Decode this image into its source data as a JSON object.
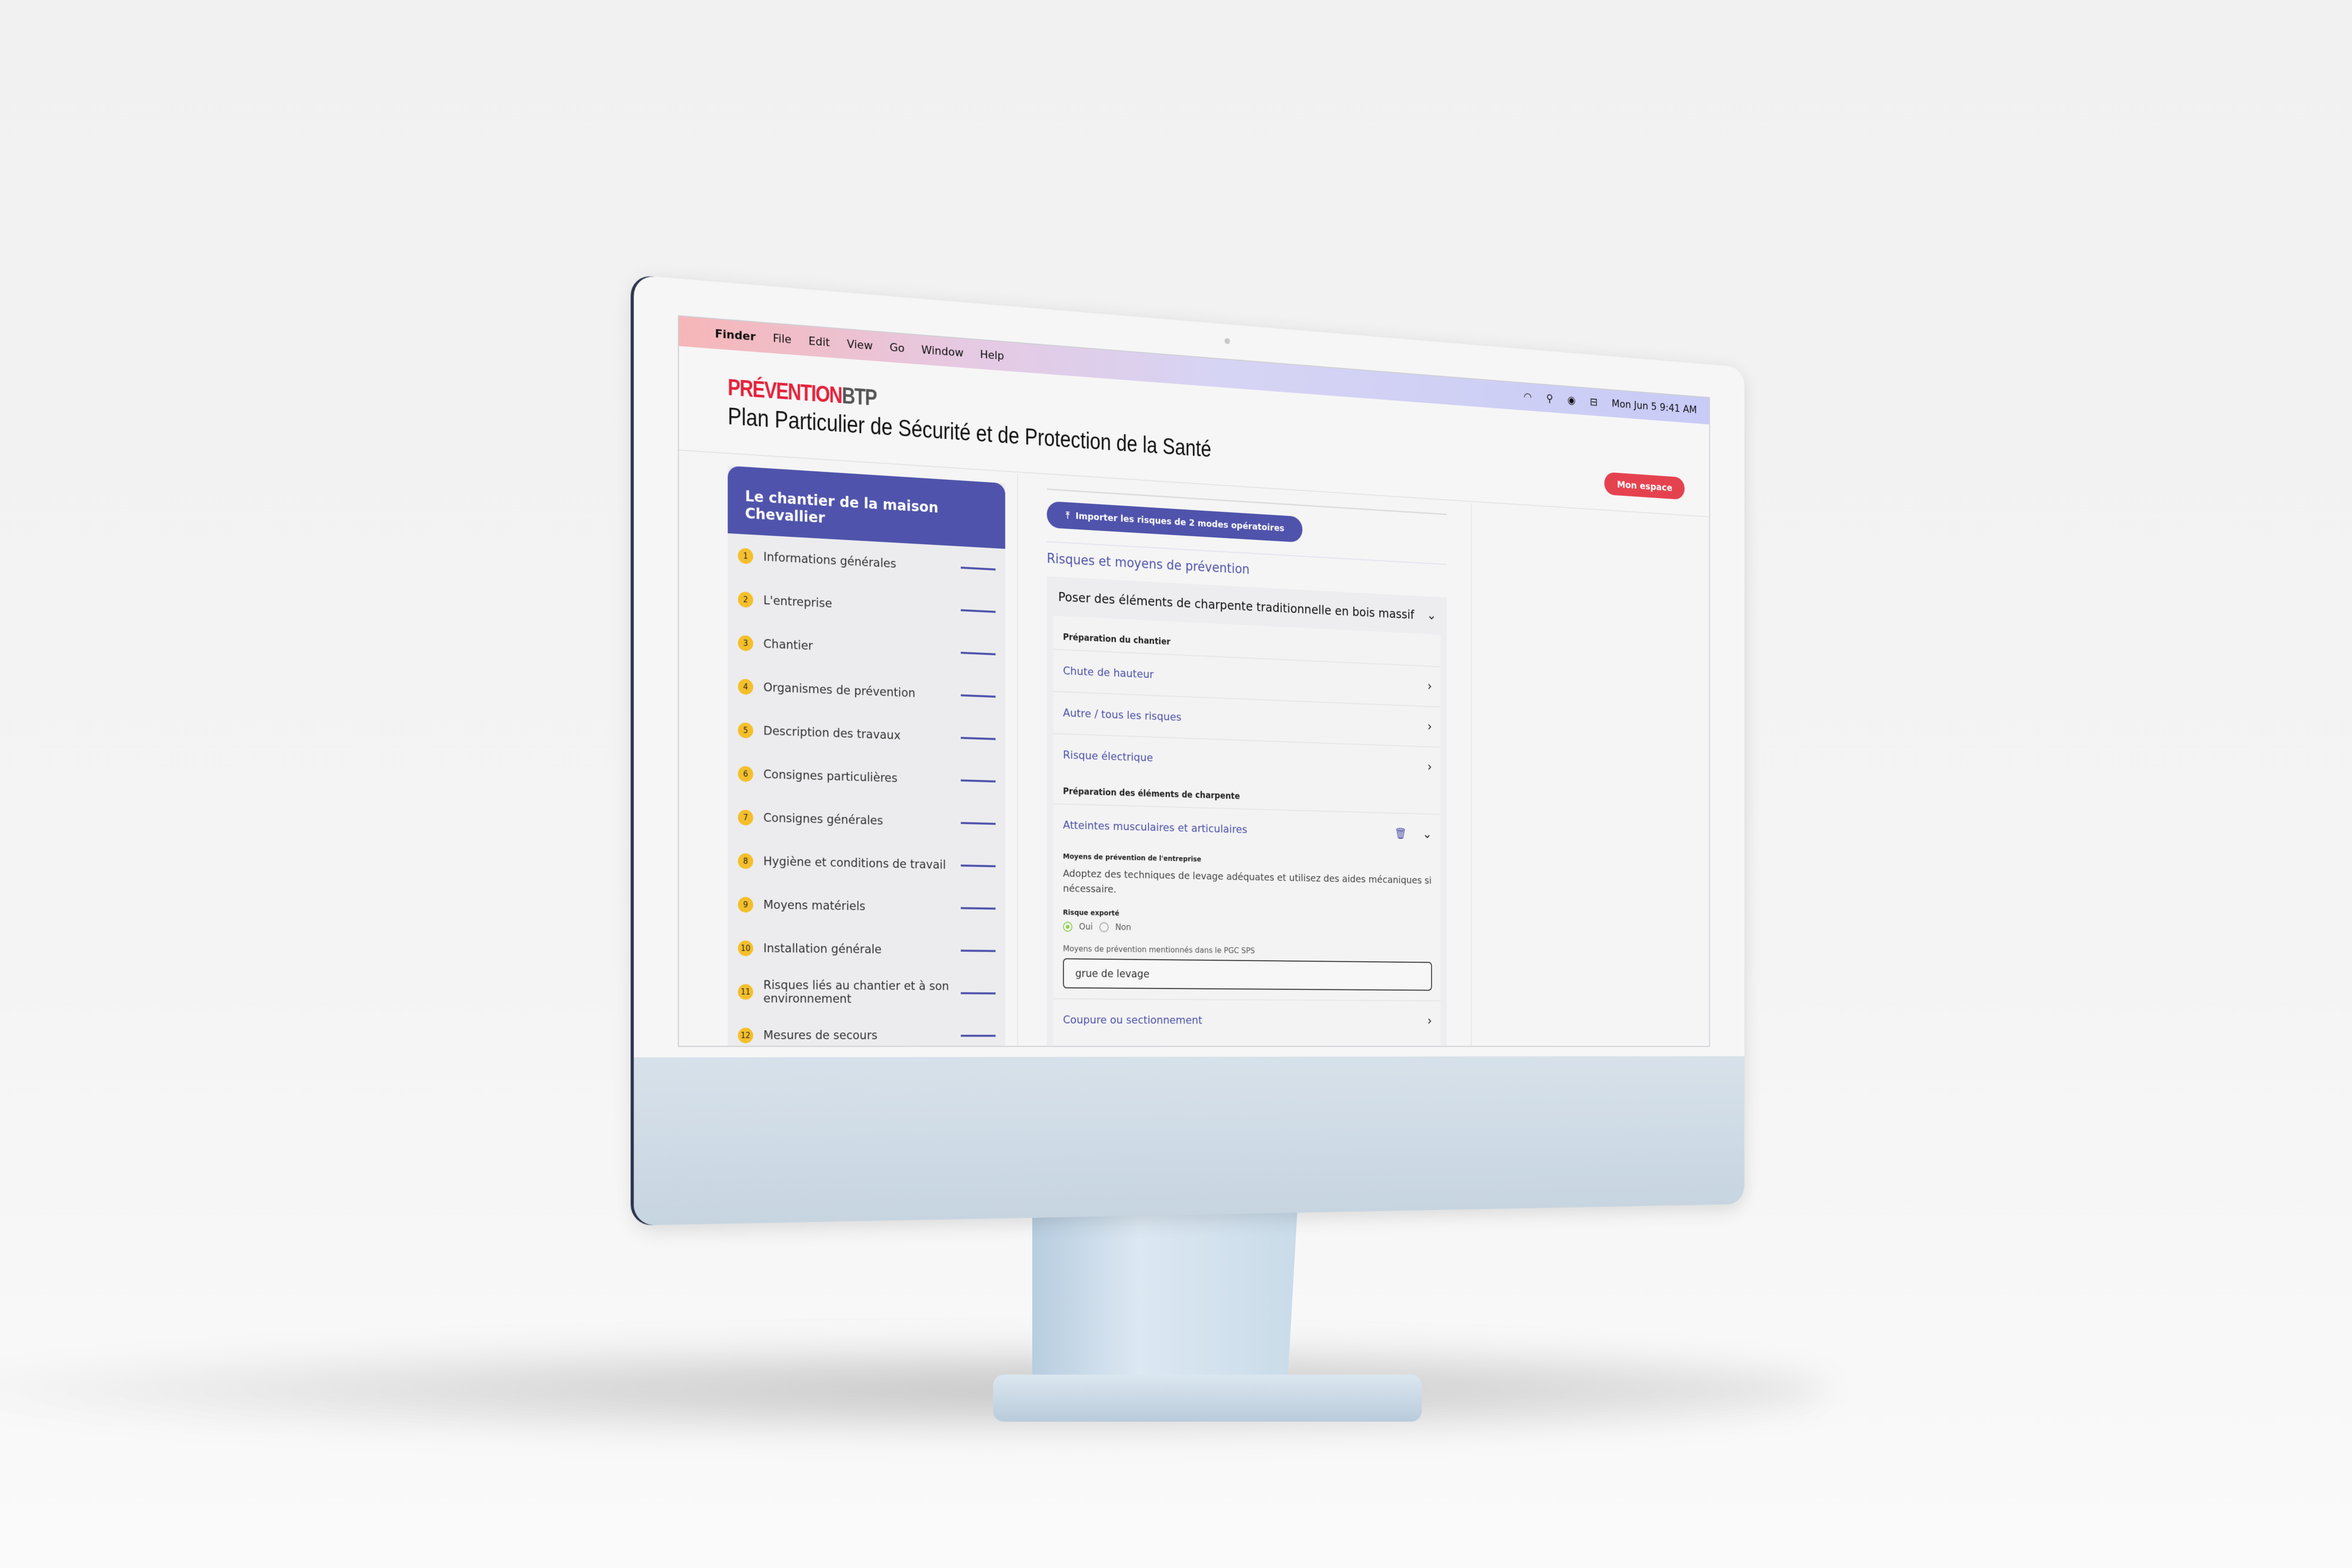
{
  "menubar": {
    "items": [
      "Finder",
      "File",
      "Edit",
      "View",
      "Go",
      "Window",
      "Help"
    ],
    "datetime": "Mon Jun 5  9:41 AM",
    "status_icons": [
      "wifi-icon",
      "search-icon",
      "user-icon",
      "control-center-icon"
    ]
  },
  "header": {
    "logo_a": "PRÉVENTION",
    "logo_b": "BTP",
    "title": "Plan Particulier de Sécurité et de Protection de la Santé",
    "account_button": "Mon espace"
  },
  "sidebar": {
    "title": "Le chantier de la maison Chevallier",
    "items": [
      {
        "n": "1",
        "label": "Informations générales"
      },
      {
        "n": "2",
        "label": "L'entreprise"
      },
      {
        "n": "3",
        "label": "Chantier"
      },
      {
        "n": "4",
        "label": "Organismes de prévention"
      },
      {
        "n": "5",
        "label": "Description des travaux"
      },
      {
        "n": "6",
        "label": "Consignes particulières"
      },
      {
        "n": "7",
        "label": "Consignes générales"
      },
      {
        "n": "8",
        "label": "Hygiène et conditions de travail"
      },
      {
        "n": "9",
        "label": "Moyens matériels"
      },
      {
        "n": "10",
        "label": "Installation générale"
      },
      {
        "n": "11",
        "label": "Risques liés au chantier et à son environnement"
      },
      {
        "n": "12",
        "label": "Mesures de secours"
      }
    ]
  },
  "main": {
    "import_button": "Importer les risques de 2 modes opératoires",
    "section_title": "Risques et moyens de prévention",
    "accordion": {
      "title": "Poser des éléments de charpente traditionnelle en bois massif",
      "group1": "Préparation du chantier",
      "group1_risks": [
        "Chute de hauteur",
        "Autre / tous les risques",
        "Risque électrique"
      ],
      "group2": "Préparation des éléments de charpente",
      "expanded": {
        "title": "Atteintes musculaires et articulaires",
        "company_label": "Moyens de prévention de l'entreprise",
        "company_text": "Adoptez des techniques de levage adéquates et utilisez des aides mécaniques si nécessaire.",
        "export_label": "Risque exporté",
        "yes": "Oui",
        "no": "Non",
        "selected": "Oui",
        "pgc_label": "Moyens de prévention mentionnés dans le PGC SPS",
        "pgc_value": "grue de levage"
      },
      "next_risk": "Coupure ou sectionnement"
    }
  },
  "colors": {
    "brand": "#4f53ab",
    "accent": "#e5424f",
    "logo_red": "#e5213b",
    "step_badge": "#f4bf2a",
    "radio_selected": "#8ccf52"
  }
}
